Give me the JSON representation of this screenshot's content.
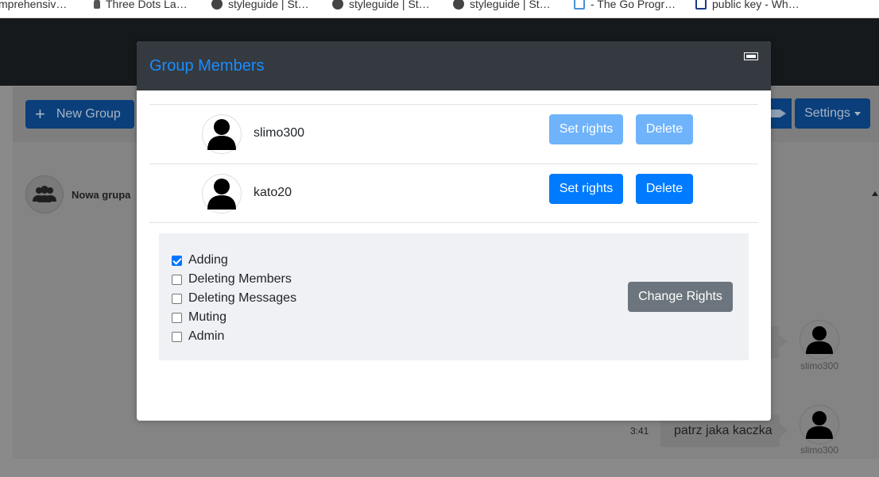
{
  "bookmarks": [
    {
      "label": "mprehensiv…",
      "icon": "none"
    },
    {
      "label": "Three Dots La…",
      "icon": "pawn-icon"
    },
    {
      "label": "styleguide | St…",
      "icon": "globe-icon"
    },
    {
      "label": "styleguide | St…",
      "icon": "globe-icon"
    },
    {
      "label": "styleguide | St…",
      "icon": "globe-icon"
    },
    {
      "label": "- The Go Progr…",
      "icon": "doc-icon"
    },
    {
      "label": "public key - Wh…",
      "icon": "key-icon"
    }
  ],
  "app": {
    "new_group_label": "New Group",
    "settings_label": "Settings",
    "group": {
      "name": "Nowa grupa"
    },
    "messages": [
      {
        "user": "slimo300",
        "text": "",
        "time": ""
      },
      {
        "user": "slimo300",
        "text": "patrz jaka kaczka",
        "time": "3:41"
      }
    ]
  },
  "modal": {
    "title": "Group Members",
    "members": [
      {
        "name": "slimo300",
        "set_rights_label": "Set rights",
        "delete_label": "Delete",
        "disabled": true
      },
      {
        "name": "kato20",
        "set_rights_label": "Set rights",
        "delete_label": "Delete",
        "disabled": false
      }
    ],
    "rights": [
      {
        "label": "Adding",
        "checked": true
      },
      {
        "label": "Deleting Members",
        "checked": false
      },
      {
        "label": "Deleting Messages",
        "checked": false
      },
      {
        "label": "Muting",
        "checked": false
      },
      {
        "label": "Admin",
        "checked": false
      }
    ],
    "change_rights_label": "Change Rights"
  },
  "colors": {
    "modal_header": "#343a40",
    "title": "#1a8cff",
    "primary": "#007bff",
    "primary_disabled": "#6fb3fb",
    "secondary": "#6c757d"
  }
}
